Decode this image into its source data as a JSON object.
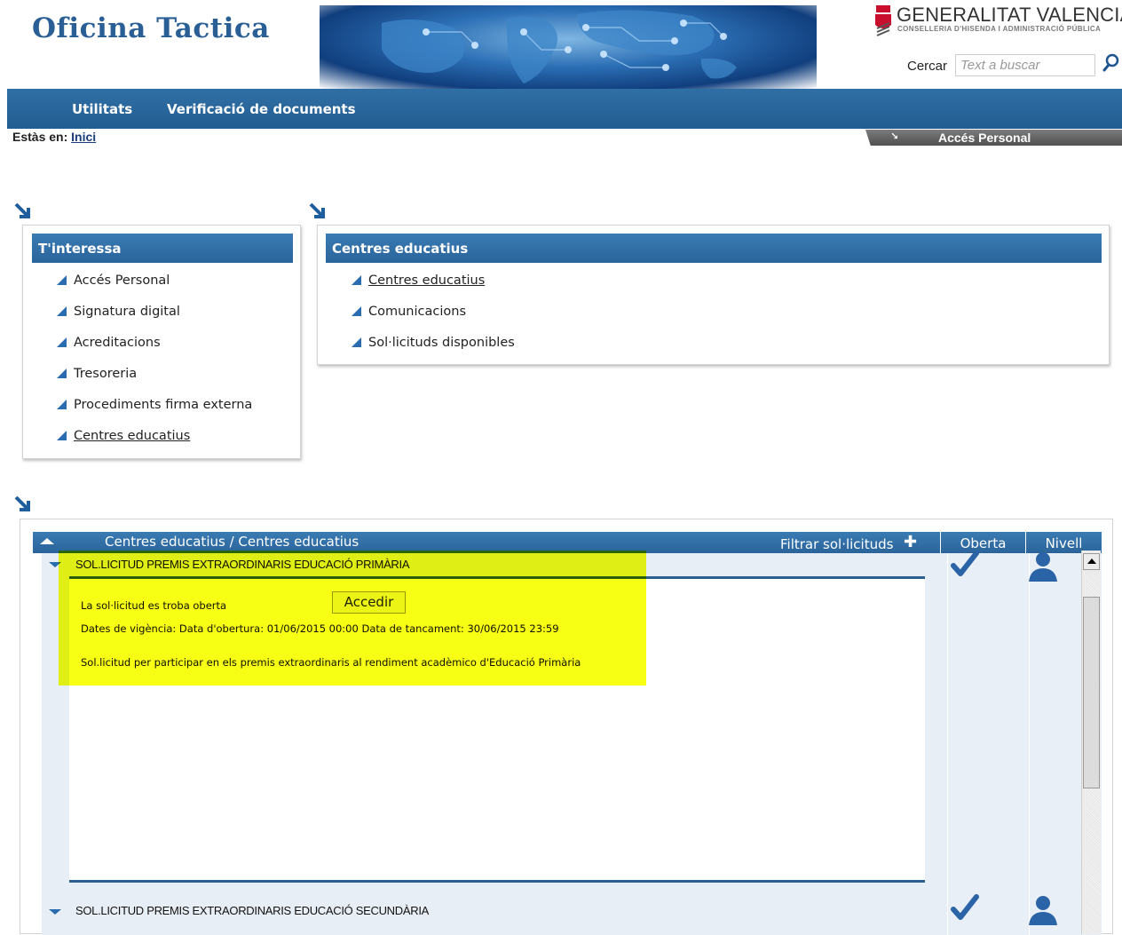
{
  "header": {
    "app_title": "Oficina Tactica",
    "org_name": "GENERALITAT VALENCIANA",
    "org_subtitle": "CONSELLERIA D'HISENDA I ADMINISTRACIÓ PÚBLICA",
    "search_label": "Cercar",
    "search_placeholder": "Text a buscar"
  },
  "nav": {
    "items": [
      {
        "label": "Utilitats"
      },
      {
        "label": "Verificació de documents"
      }
    ]
  },
  "breadcrumb": {
    "prefix": "Estàs en:",
    "link": "Inici"
  },
  "personal_access": {
    "arrow": "↘",
    "label": "Accés Personal"
  },
  "box_interessa": {
    "title": "T'interessa",
    "items": [
      {
        "label": "Accés Personal"
      },
      {
        "label": "Signatura digital"
      },
      {
        "label": "Acreditacions"
      },
      {
        "label": "Tresoreria"
      },
      {
        "label": "Procediments firma externa"
      },
      {
        "label": "Centres educatius"
      }
    ]
  },
  "box_centres": {
    "title": "Centres educatius",
    "items": [
      {
        "label": "Centres educatius"
      },
      {
        "label": "Comunicacions"
      },
      {
        "label": "Sol·licituds disponibles"
      }
    ]
  },
  "panel": {
    "title": "Centres educatius / Centres educatius",
    "filter_label": "Filtrar sol·licituds",
    "filter_icon": "plus-icon",
    "columns": [
      {
        "label": "Oberta"
      },
      {
        "label": "Nivell"
      }
    ],
    "rows": [
      {
        "title": "SOL.LICITUD PREMIS EXTRAORDINARIS EDUCACIÓ PRIMÀRIA",
        "status": "La sol·licitud es troba oberta",
        "action": "Accedir",
        "dates": "Dates de vigència: Data d'obertura: 01/06/2015 00:00 Data de tancament: 30/06/2015 23:59",
        "description": "Sol.licitud per participar en els premis extraordinaris al rendiment acadèmico d'Educació Primària"
      },
      {
        "title": "SOL.LICITUD PREMIS EXTRAORDINARIS EDUCACIÓ SECUNDÀRIA"
      }
    ]
  },
  "colors": {
    "brand_blue": "#2a649b",
    "title_blue": "#2a5f95",
    "highlight": "#f5ff00"
  }
}
